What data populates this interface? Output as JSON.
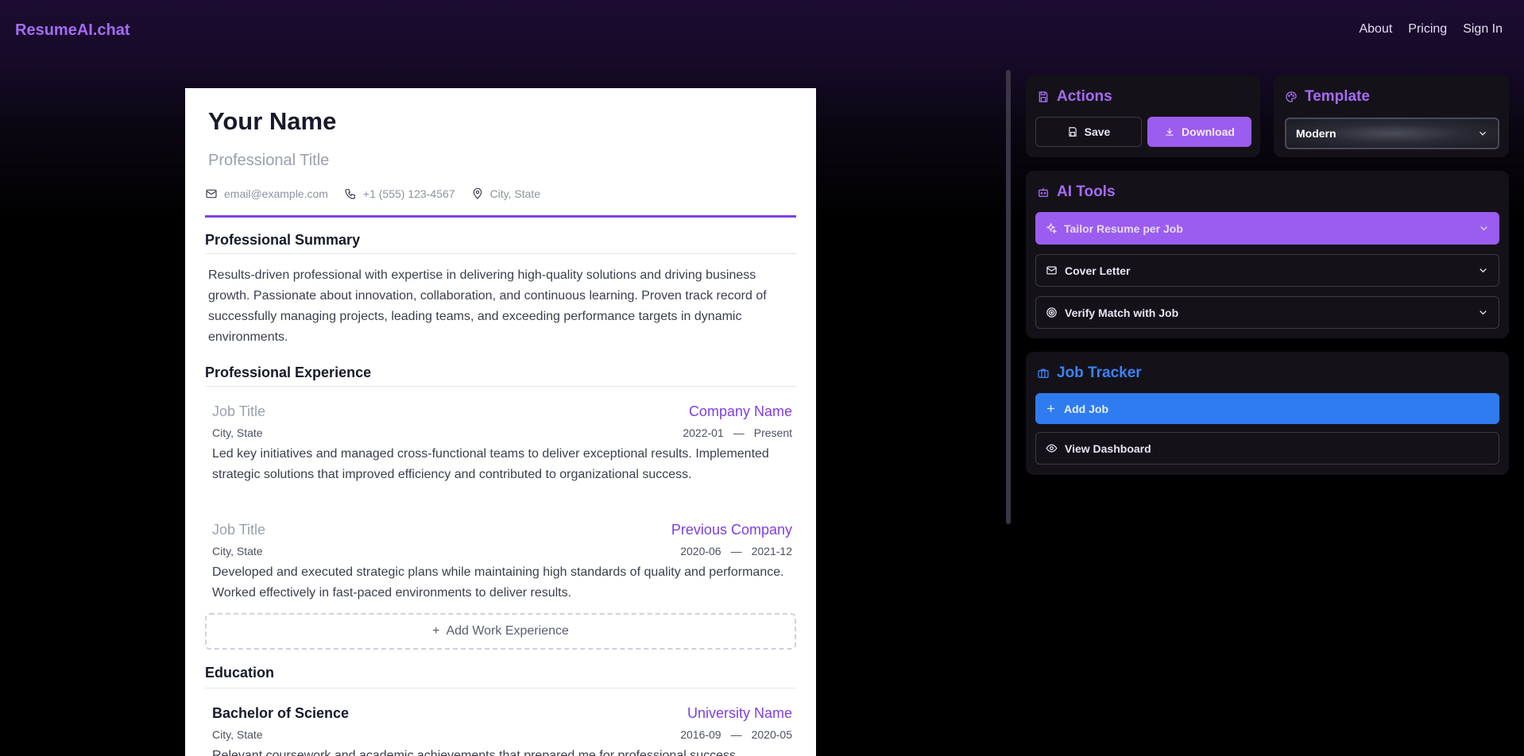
{
  "header": {
    "logo": "ResumeAI.chat",
    "nav": [
      "About",
      "Pricing",
      "Sign In"
    ]
  },
  "resume": {
    "name": "Your Name",
    "title": "Professional Title",
    "email": "email@example.com",
    "phone": "+1 (555) 123-4567",
    "location": "City, State",
    "summary_heading": "Professional Summary",
    "summary": "Results-driven professional with expertise in delivering high-quality solutions and driving business growth. Passionate about innovation, collaboration, and continuous learning. Proven track record of successfully managing projects, leading teams, and exceeding performance targets in dynamic environments.",
    "experience_heading": "Professional Experience",
    "experience": [
      {
        "title": "Job Title",
        "company": "Company Name",
        "location": "City, State",
        "start": "2022-01",
        "separator": "—",
        "end": "Present",
        "description": "Led key initiatives and managed cross-functional teams to deliver exceptional results. Implemented strategic solutions that improved efficiency and contributed to organizational success."
      },
      {
        "title": "Job Title",
        "company": "Previous Company",
        "location": "City, State",
        "start": "2020-06",
        "separator": "—",
        "end": "2021-12",
        "description": "Developed and executed strategic plans while maintaining high standards of quality and performance. Worked effectively in fast-paced environments to deliver results."
      }
    ],
    "add_experience_label": "Add Work Experience",
    "education_heading": "Education",
    "education": [
      {
        "degree": "Bachelor of Science",
        "school": "University Name",
        "location": "City, State",
        "start": "2016-09",
        "separator": "—",
        "end": "2020-05",
        "description": "Relevant coursework and academic achievements that prepared me for professional success."
      }
    ]
  },
  "actions": {
    "heading": "Actions",
    "save_label": "Save",
    "download_label": "Download"
  },
  "template": {
    "heading": "Template",
    "selected": "Modern"
  },
  "ai_tools": {
    "heading": "AI Tools",
    "items": [
      "Tailor Resume per Job",
      "Cover Letter",
      "Verify Match with Job"
    ]
  },
  "job_tracker": {
    "heading": "Job Tracker",
    "add_label": "Add Job",
    "dashboard_label": "View Dashboard"
  },
  "colors": {
    "accent_purple": "#9b5cf0",
    "accent_blue": "#2f7cf0",
    "brand": "#a56bf5"
  }
}
